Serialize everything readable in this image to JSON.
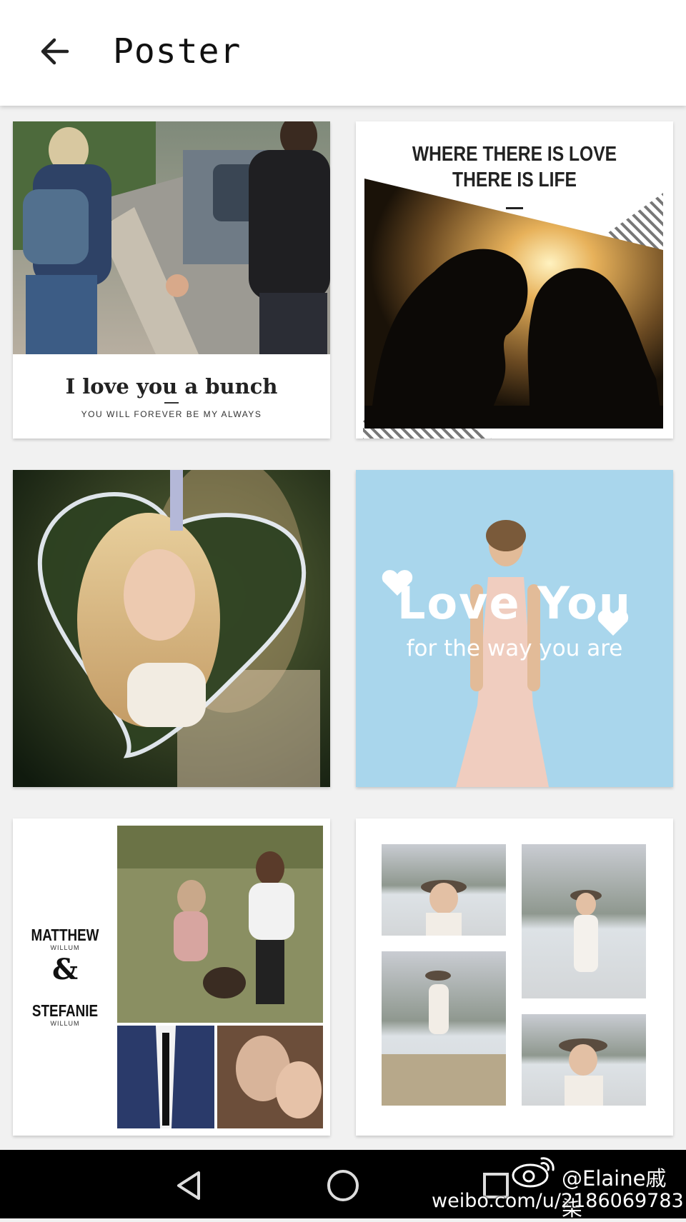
{
  "header": {
    "title": "Poster",
    "back_icon": "arrow-left-icon"
  },
  "posters": [
    {
      "headline": "I love you a bunch",
      "subline": "YOU WILL FOREVER BE MY ALWAYS"
    },
    {
      "headline_line1": "WHERE THERE IS LOVE",
      "headline_line2": "THERE IS LIFE"
    },
    {
      "style": "crystal-heart-frame"
    },
    {
      "headline": "Love You",
      "subline": "for the way you are"
    },
    {
      "name1": "MATTHEW",
      "name1_sub": "WILLUM",
      "ampersand": "&",
      "name2": "STEFANIE",
      "name2_sub": "WILLUM"
    },
    {
      "style": "photo-collage"
    }
  ],
  "navbar": {
    "icons": [
      "back-triangle-icon",
      "home-circle-icon",
      "recents-square-icon"
    ]
  },
  "watermark": {
    "handle": "@Elaine戚柒",
    "url": "weibo.com/u/2186069783"
  },
  "colors": {
    "appbar": "#ffffff",
    "background": "#f1f1f1",
    "navbar": "#000000",
    "sky": "#a9d6ec"
  }
}
